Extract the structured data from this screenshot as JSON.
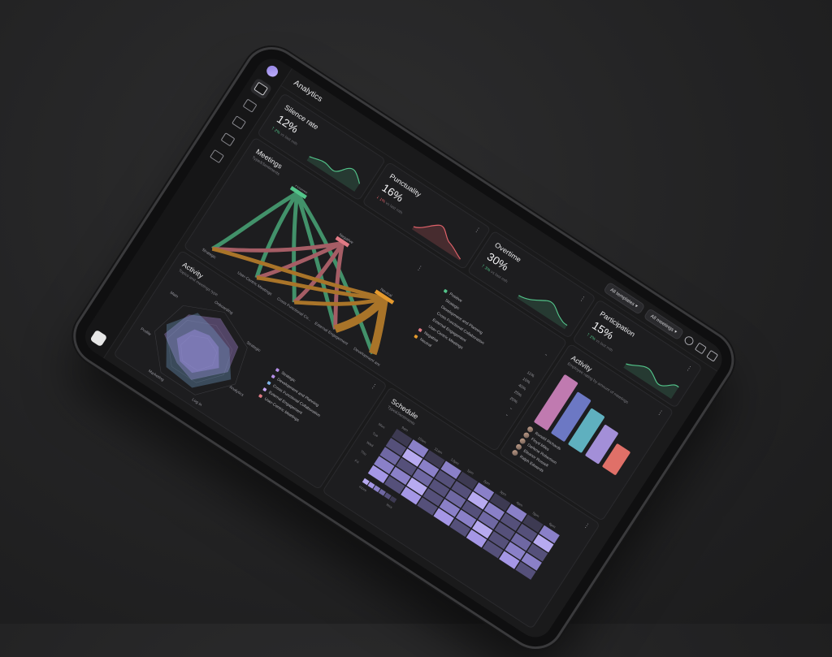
{
  "app": {
    "title": "Analytics"
  },
  "filters": {
    "templates": "All templates",
    "meetings": "All meetings"
  },
  "kpis": [
    {
      "title": "Silence rate",
      "value": "12%",
      "change": "2%",
      "trend": "up",
      "note": "vs last mth",
      "color": "#53c48a"
    },
    {
      "title": "Punctuality",
      "value": "16%",
      "change": "1%",
      "trend": "down",
      "note": "vs last mth",
      "color": "#e0626a"
    },
    {
      "title": "Overtime",
      "value": "30%",
      "change": "3%",
      "trend": "up",
      "note": "vs last mth",
      "color": "#53c48a"
    },
    {
      "title": "Participation",
      "value": "15%",
      "change": "2%",
      "trend": "up",
      "note": "vs last mth",
      "color": "#53c48a"
    }
  ],
  "meetings": {
    "title": "Meetings",
    "subtitle": "Type&Sentiments",
    "sources": [
      "Strategic",
      "User-Centric Meetings",
      "Cross Functional Co...",
      "External Engagement",
      "Development and Pl..."
    ],
    "targets": [
      "Positive",
      "Negative",
      "Neutral"
    ],
    "legend_groups": [
      {
        "label": "Positive",
        "color": "#53c48a"
      },
      {
        "label": "Negative",
        "color": "#e07a84"
      },
      {
        "label": "Neutral",
        "color": "#e59a2e"
      }
    ],
    "legend_items": [
      {
        "label": "Strategic",
        "pct": ""
      },
      {
        "label": "Development and Planning",
        "pct": ""
      },
      {
        "label": "Cross Functional Collaboration",
        "pct": "11%"
      },
      {
        "label": "External Engagement",
        "pct": "10%"
      },
      {
        "label": "User-Centric Meetings",
        "pct": "40%"
      },
      {
        "label": "",
        "pct": "25%"
      },
      {
        "label": "",
        "pct": "20%"
      }
    ]
  },
  "activity_radar": {
    "title": "Activity",
    "subtitle": "Topics and meetings type",
    "axes": [
      "Onboarding",
      "Strategic",
      "Analytics",
      "Log in",
      "Marketing",
      "Profile",
      "Main"
    ],
    "legend": [
      {
        "label": "Strategic",
        "color": "#b58fe8"
      },
      {
        "label": "Development and Planning",
        "color": "#b58fe8"
      },
      {
        "label": "Cross Functional Collaboration",
        "color": "#7fb2e5"
      },
      {
        "label": "External Engagement",
        "color": "#c7a7f5"
      },
      {
        "label": "User-Centric Meetings",
        "color": "#e07a84"
      }
    ]
  },
  "activity_bars": {
    "title": "Activity",
    "subtitle": "Employee rating by amount of meetings",
    "people": [
      {
        "name": "Ronald Richards",
        "value": 92,
        "color": "#c07ab0"
      },
      {
        "name": "Floyd Miles",
        "value": 80,
        "color": "#6c78c4"
      },
      {
        "name": "Darlene Robertson",
        "value": 70,
        "color": "#5fb0bf"
      },
      {
        "name": "Eleanor Russell",
        "value": 60,
        "color": "#a38fd8"
      },
      {
        "name": "Ralph Edwards",
        "value": 45,
        "color": "#e07068"
      }
    ]
  },
  "schedule": {
    "title": "Schedule",
    "subtitle": "Type&Sentiments",
    "hours": [
      "9am",
      "10am",
      "11am",
      "12pm",
      "1pm",
      "2pm",
      "3pm",
      "4pm",
      "5pm",
      "6pm"
    ],
    "days": [
      "Mon",
      "Tue",
      "Wed",
      "Thu",
      "Fri"
    ],
    "scale_more": "more",
    "scale_less": "less"
  },
  "colors": {
    "accent": "#a897f0",
    "positive": "#53c48a",
    "negative": "#e07a84",
    "neutral": "#e59a2e"
  }
}
